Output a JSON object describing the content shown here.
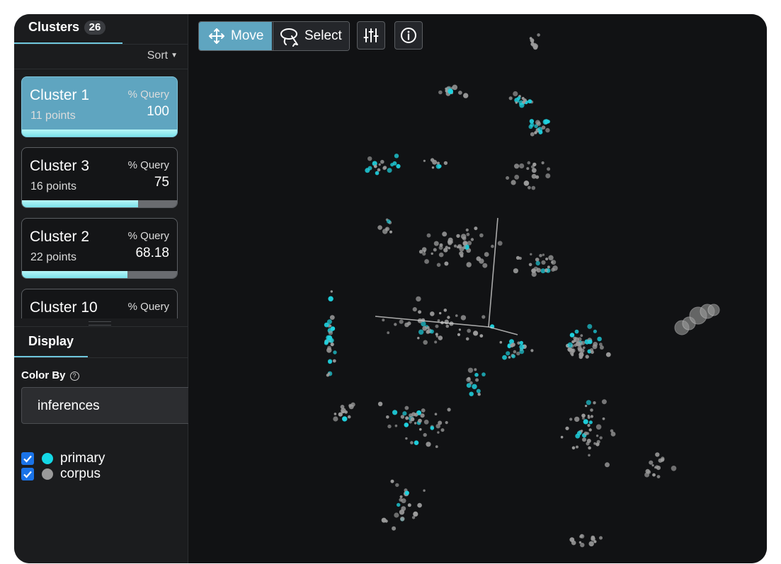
{
  "sidebar": {
    "clusters_tab": {
      "label": "Clusters",
      "count": "26"
    },
    "sort_label": "Sort",
    "clusters": [
      {
        "name": "Cluster 1",
        "points": "11 points",
        "query_label": "% Query",
        "query_value": "100",
        "query_fraction": 1.0,
        "selected": true
      },
      {
        "name": "Cluster 3",
        "points": "16 points",
        "query_label": "% Query",
        "query_value": "75",
        "query_fraction": 0.75,
        "selected": false
      },
      {
        "name": "Cluster 2",
        "points": "22 points",
        "query_label": "% Query",
        "query_value": "68.18",
        "query_fraction": 0.6818,
        "selected": false
      },
      {
        "name": "Cluster 10",
        "points": "",
        "query_label": "% Query",
        "query_value": "",
        "query_fraction": 0,
        "selected": false
      }
    ],
    "display_tab": {
      "label": "Display"
    },
    "color_by": {
      "label": "Color By",
      "value": "inferences"
    },
    "legend": [
      {
        "label": "primary",
        "color": "#14d8e6",
        "checked": true
      },
      {
        "label": "corpus",
        "color": "#9a9a9a",
        "checked": true
      }
    ]
  },
  "toolbar": {
    "move_label": "Move",
    "select_label": "Select",
    "active_mode": "move"
  },
  "scatter": {
    "colors": {
      "primary": "#1fd3e0",
      "corpus": "#9c9c9c",
      "axis": "#cfcfcf",
      "background": "#111214"
    }
  }
}
